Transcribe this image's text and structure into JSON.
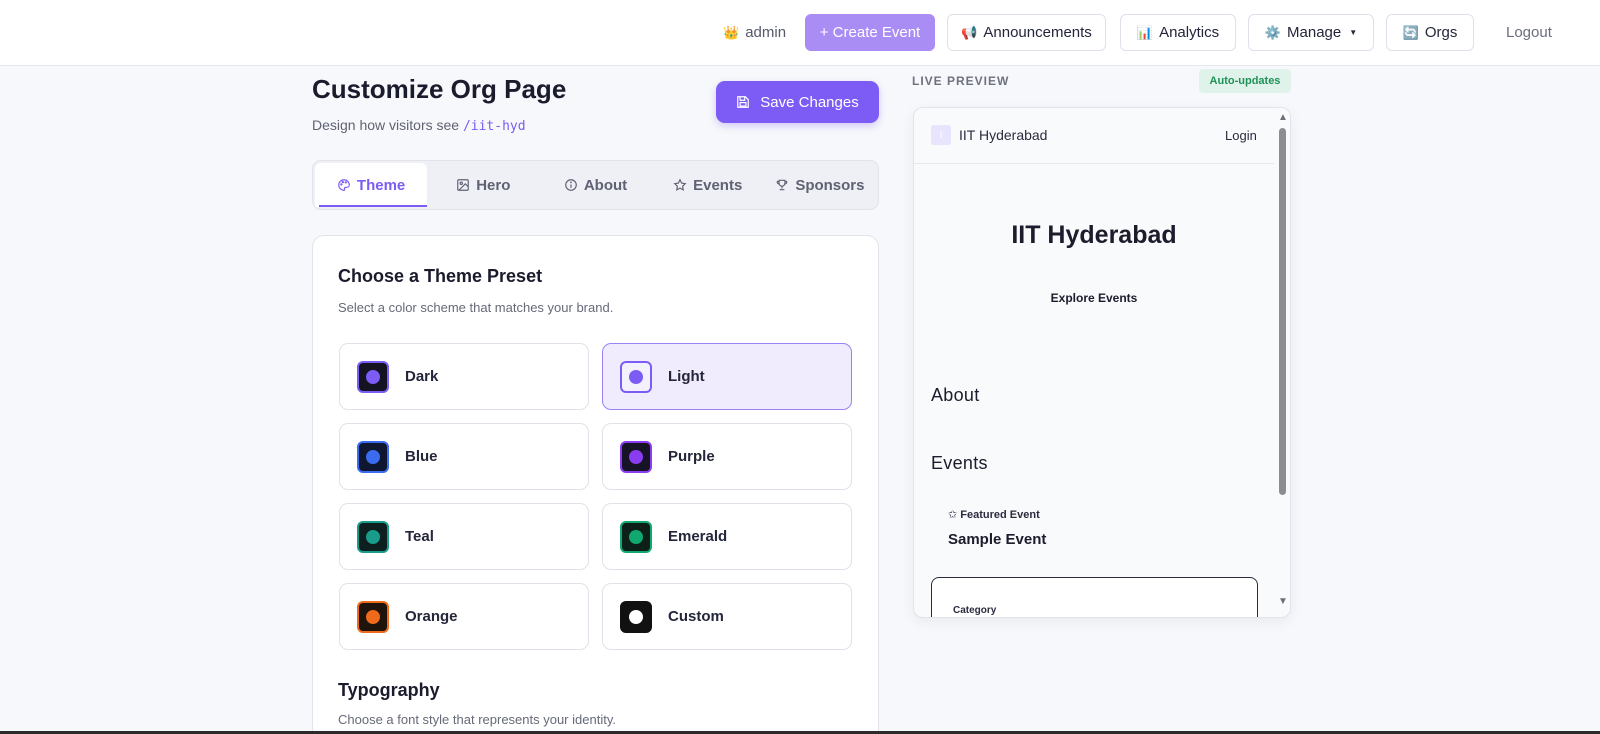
{
  "navbar": {
    "user": "admin",
    "user_icon": "crown-icon",
    "create_event": "+ Create Event",
    "announcements": "Announcements",
    "analytics": "Analytics",
    "manage": "Manage",
    "orgs": "Orgs",
    "logout": "Logout"
  },
  "page": {
    "title": "Customize Org Page",
    "subtitle_prefix": "Design how visitors see",
    "slug": "/iit-hyd",
    "save_label": "Save Changes"
  },
  "tabs": [
    {
      "label": "Theme",
      "icon": "palette-icon",
      "active": true
    },
    {
      "label": "Hero",
      "icon": "image-icon"
    },
    {
      "label": "About",
      "icon": "info-icon"
    },
    {
      "label": "Events",
      "icon": "star-icon"
    },
    {
      "label": "Sponsors",
      "icon": "trophy-icon"
    }
  ],
  "theme": {
    "title": "Choose a Theme Preset",
    "subtitle": "Select a color scheme that matches your brand.",
    "presets": [
      {
        "label": "Dark",
        "bg": "#141322",
        "border": "#7c5cf5",
        "dot": "#7c5cf5"
      },
      {
        "label": "Light",
        "bg": "#f4f1ff",
        "border": "#7c5cf5",
        "dot": "#7c5cf5",
        "selected": true
      },
      {
        "label": "Blue",
        "bg": "#0f1630",
        "border": "#3b6cf0",
        "dot": "#3b6cf0"
      },
      {
        "label": "Purple",
        "bg": "#171326",
        "border": "#8a3cf0",
        "dot": "#8a3cf0"
      },
      {
        "label": "Teal",
        "bg": "#0d1f1f",
        "border": "#1a9c8a",
        "dot": "#1a9c8a"
      },
      {
        "label": "Emerald",
        "bg": "#0c1f18",
        "border": "#10a86e",
        "dot": "#10a86e"
      },
      {
        "label": "Orange",
        "bg": "#1f140c",
        "border": "#f06a1c",
        "dot": "#f06a1c"
      },
      {
        "label": "Custom",
        "bg": "#111111",
        "border": "#111111",
        "dot": "#ffffff"
      }
    ]
  },
  "typography": {
    "title": "Typography",
    "subtitle": "Choose a font style that represents your identity."
  },
  "live_preview": {
    "label": "LIVE PREVIEW",
    "badge": "Auto-updates",
    "org_name": "IIT Hyderabad",
    "logo_letter": "I",
    "login": "Login",
    "hero_title": "IIT Hyderabad",
    "hero_button": "Explore Events",
    "about_heading": "About",
    "events_heading": "Events",
    "featured": "✩ Featured Event",
    "event_name": "Sample Event",
    "card_label": "Category"
  },
  "colors": {
    "accent": "#7c5cf5",
    "accent_light": "#a98df5",
    "badge_green": "#1f9159"
  }
}
